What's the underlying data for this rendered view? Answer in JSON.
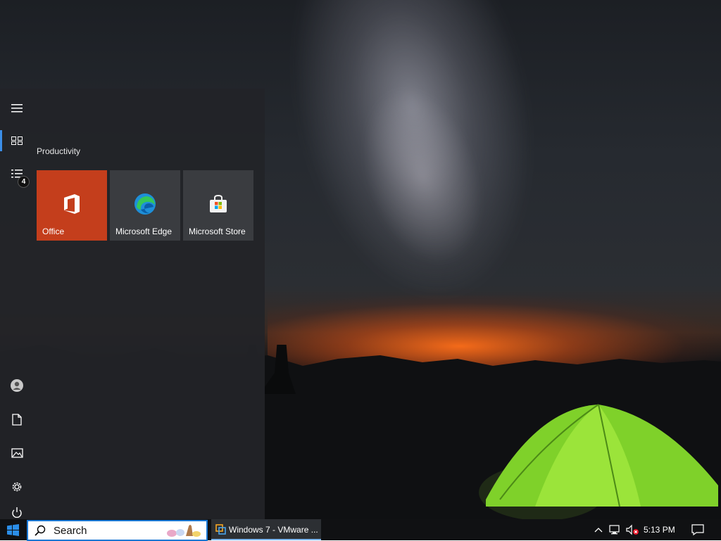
{
  "start_menu": {
    "group_title": "Productivity",
    "tiles": [
      {
        "label": "Office",
        "color": "#c43e1c",
        "icon": "office-logo"
      },
      {
        "label": "Microsoft Edge",
        "color": "#3a3c40",
        "icon": "edge-logo"
      },
      {
        "label": "Microsoft Store",
        "color": "#3a3c40",
        "icon": "store-bag"
      }
    ],
    "rail": {
      "top": [
        "hamburger-menu-icon",
        "tiles-icon",
        "all-apps-icon"
      ],
      "all_apps_badge": "4",
      "bottom": [
        "user-icon",
        "documents-icon",
        "pictures-icon",
        "settings-icon",
        "power-icon"
      ]
    },
    "accent_color": "#3b8ee8"
  },
  "taskbar": {
    "search_placeholder": "Search",
    "task_button_label": "Windows 7 - VMware ...",
    "clock": "5:13 PM",
    "tray_icons": [
      "chevron-up-icon",
      "network-icon",
      "volume-muted-icon",
      "notification-icon"
    ],
    "accent_color": "#1a78d4"
  }
}
